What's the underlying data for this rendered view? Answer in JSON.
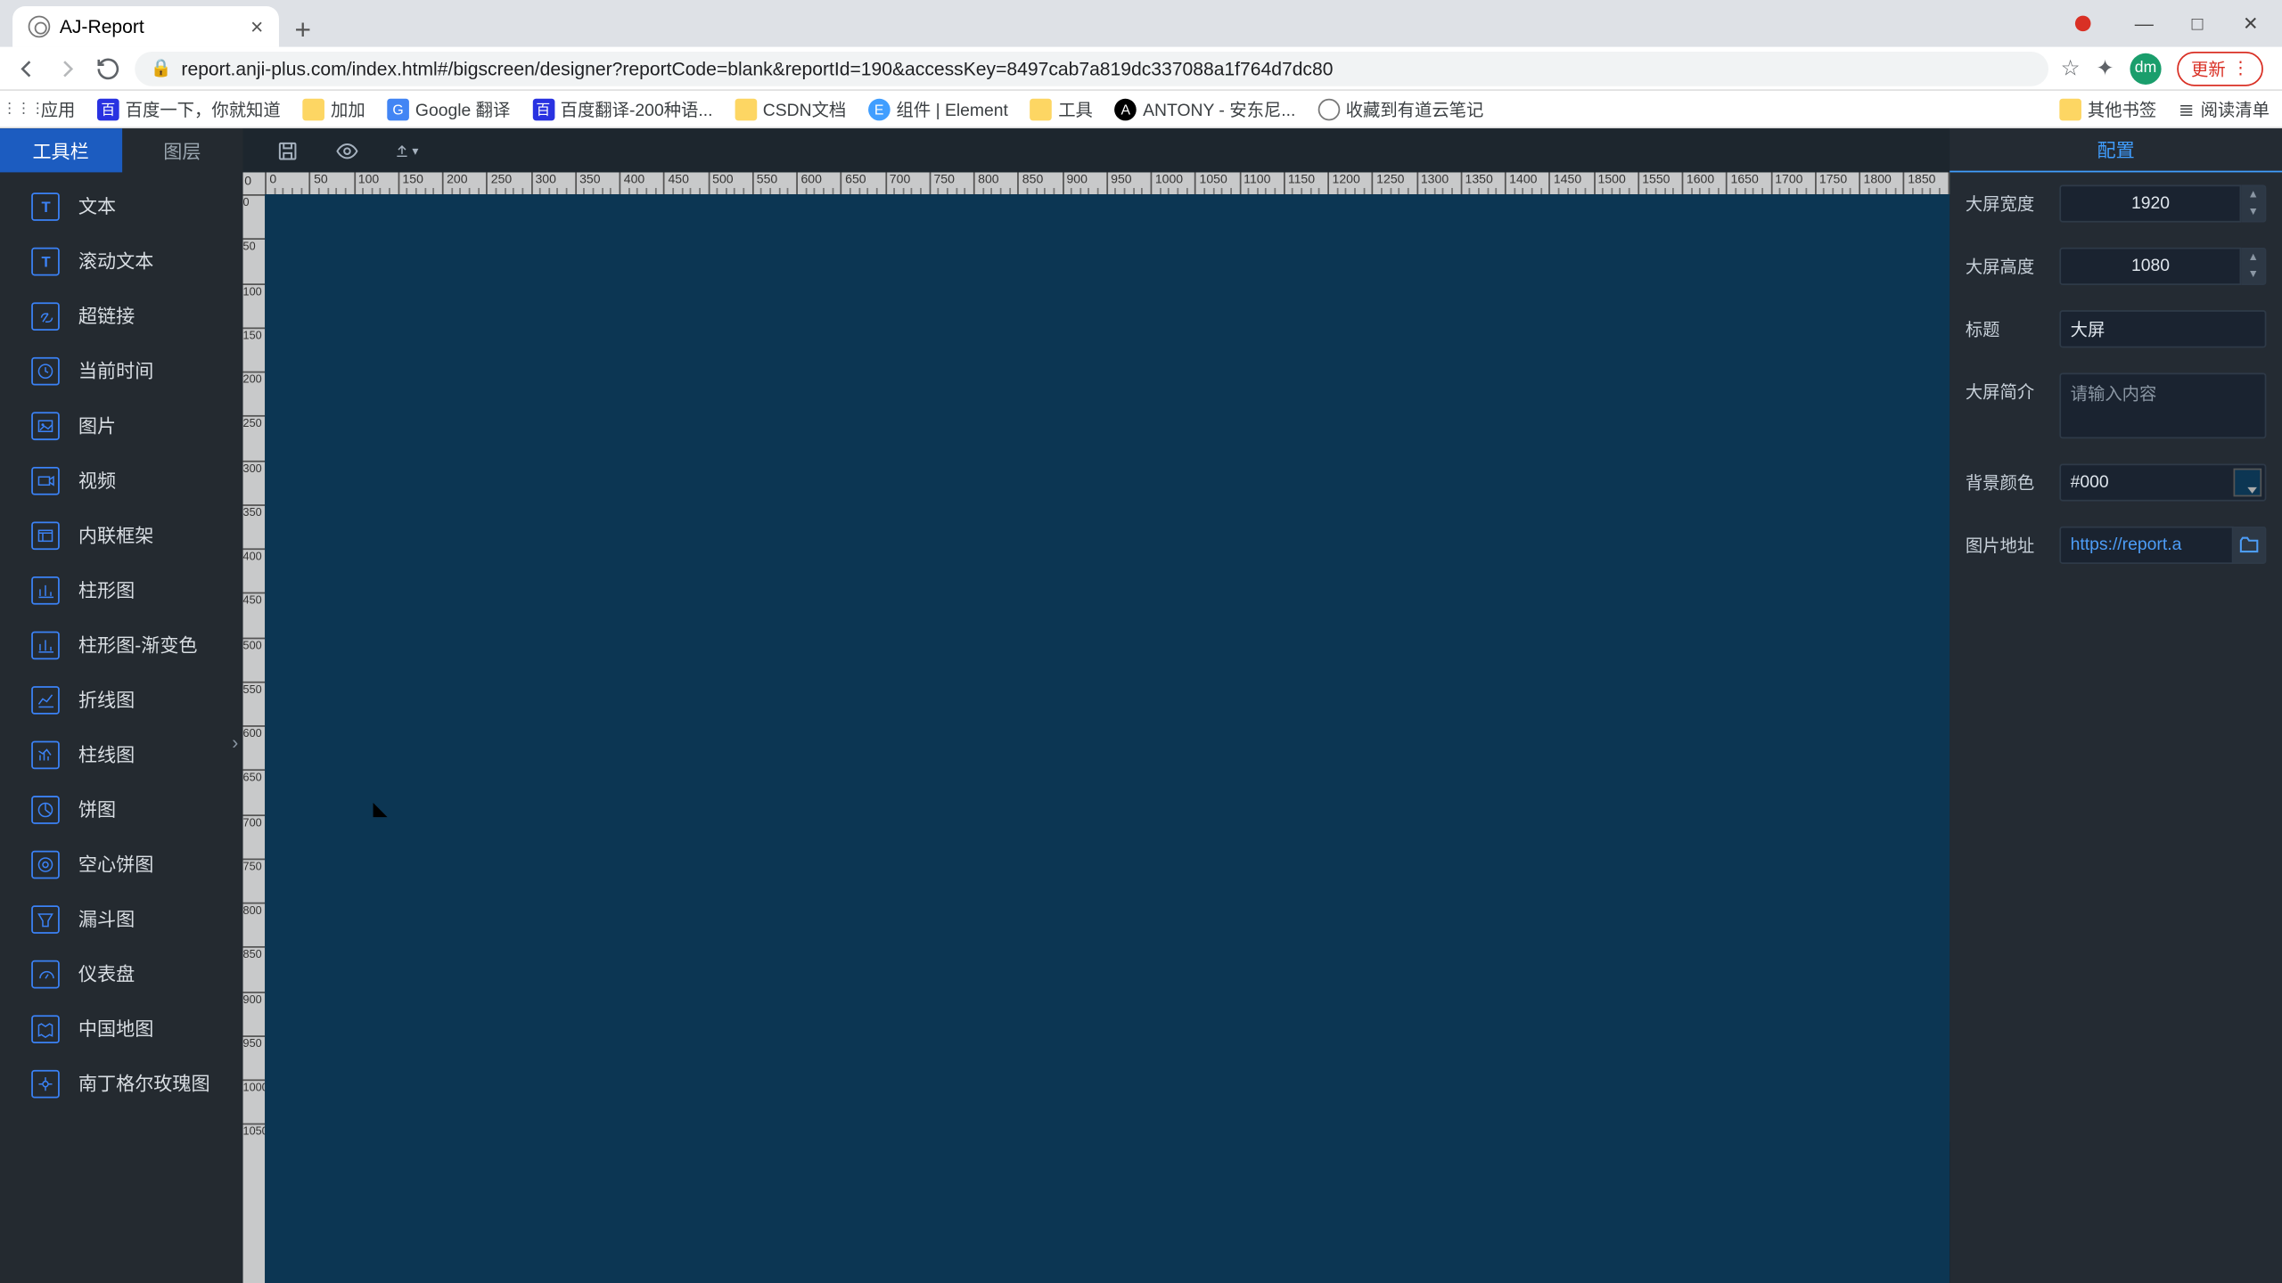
{
  "browser": {
    "tab_title": "AJ-Report",
    "url": "report.anji-plus.com/index.html#/bigscreen/designer?reportCode=blank&reportId=190&accessKey=8497cab7a819dc337088a1f764d7dc80",
    "avatar_initials": "dm",
    "update_label": "更新",
    "bookmarks": [
      {
        "label": "应用",
        "kind": "apps"
      },
      {
        "label": "百度一下，你就知道",
        "kind": "baidu"
      },
      {
        "label": "加加",
        "kind": "folder"
      },
      {
        "label": "Google 翻译",
        "kind": "google"
      },
      {
        "label": "百度翻译-200种语...",
        "kind": "baidu"
      },
      {
        "label": "CSDN文档",
        "kind": "folder"
      },
      {
        "label": "组件 | Element",
        "kind": "elem"
      },
      {
        "label": "工具",
        "kind": "folder"
      },
      {
        "label": "ANTONY - 安东尼...",
        "kind": "ant"
      },
      {
        "label": "收藏到有道云笔记",
        "kind": "globe"
      }
    ],
    "bm_right": {
      "other": "其他书签",
      "reading": "阅读清单"
    }
  },
  "sidebar": {
    "tabs": {
      "toolbar": "工具栏",
      "layer": "图层"
    },
    "items": [
      {
        "label": "文本",
        "icon": "T"
      },
      {
        "label": "滚动文本",
        "icon": "T"
      },
      {
        "label": "超链接",
        "icon": "link"
      },
      {
        "label": "当前时间",
        "icon": "clock"
      },
      {
        "label": "图片",
        "icon": "img"
      },
      {
        "label": "视频",
        "icon": "video"
      },
      {
        "label": "内联框架",
        "icon": "iframe"
      },
      {
        "label": "柱形图",
        "icon": "bar"
      },
      {
        "label": "柱形图-渐变色",
        "icon": "bar"
      },
      {
        "label": "折线图",
        "icon": "line"
      },
      {
        "label": "柱线图",
        "icon": "barline"
      },
      {
        "label": "饼图",
        "icon": "pie"
      },
      {
        "label": "空心饼图",
        "icon": "donut"
      },
      {
        "label": "漏斗图",
        "icon": "funnel"
      },
      {
        "label": "仪表盘",
        "icon": "gauge"
      },
      {
        "label": "中国地图",
        "icon": "map"
      },
      {
        "label": "南丁格尔玫瑰图",
        "icon": "rose"
      }
    ]
  },
  "rpanel": {
    "tab": "配置",
    "width_label": "大屏宽度",
    "width_value": "1920",
    "height_label": "大屏高度",
    "height_value": "1080",
    "title_label": "标题",
    "title_value": "大屏",
    "desc_label": "大屏简介",
    "desc_placeholder": "请输入内容",
    "bg_label": "背景颜色",
    "bg_value": "#000",
    "img_label": "图片地址",
    "img_value": "https://report.a"
  },
  "ruler_corner": "0"
}
